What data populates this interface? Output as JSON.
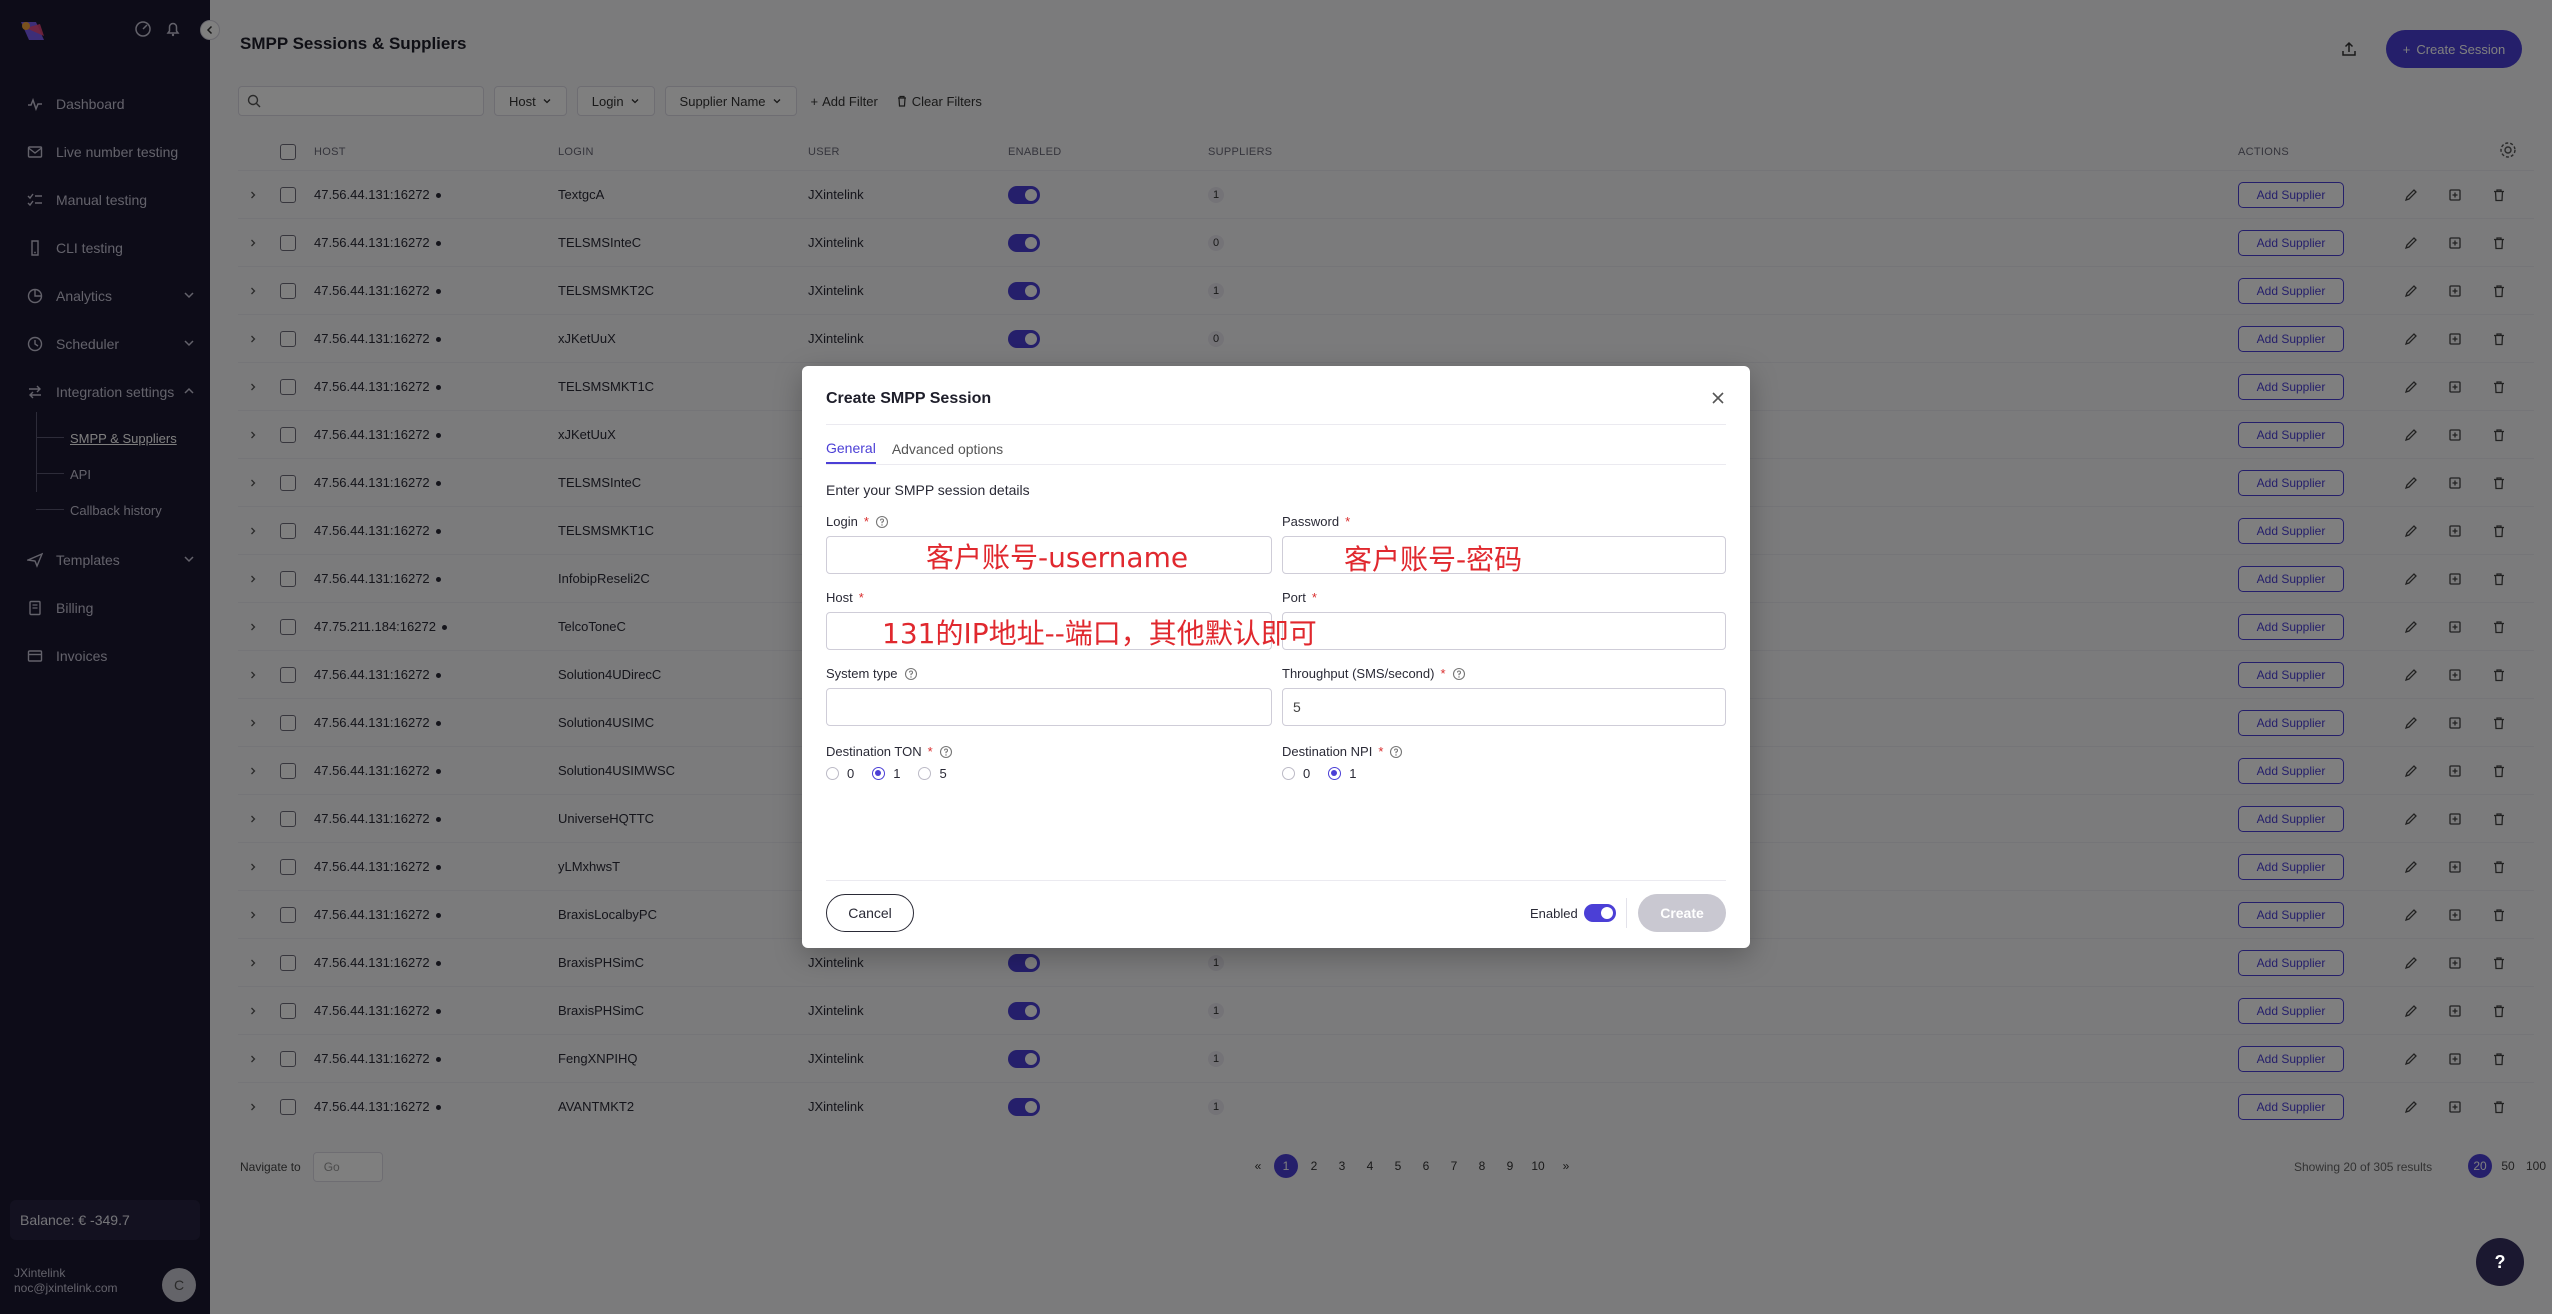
{
  "sidebar": {
    "items": [
      {
        "label": "Dashboard",
        "icon": "pulse-icon"
      },
      {
        "label": "Live number testing",
        "icon": "mail-icon"
      },
      {
        "label": "Manual testing",
        "icon": "checklist-icon"
      },
      {
        "label": "CLI testing",
        "icon": "phone-icon"
      },
      {
        "label": "Analytics",
        "icon": "chart-icon"
      },
      {
        "label": "Scheduler",
        "icon": "clock-icon"
      },
      {
        "label": "Integration settings",
        "icon": "arrows-icon"
      }
    ],
    "sub_items": [
      "SMPP & Suppliers",
      "API",
      "Callback history"
    ],
    "items2": [
      {
        "label": "Templates",
        "icon": "send-icon"
      },
      {
        "label": "Billing",
        "icon": "doc-icon"
      },
      {
        "label": "Invoices",
        "icon": "card-icon"
      }
    ],
    "balance": "Balance: € -349.7",
    "user_name": "JXintelink",
    "user_email": "noc@jxintelink.com",
    "avatar_initial": "C"
  },
  "main": {
    "title": "SMPP Sessions & Suppliers",
    "create_button": "Create Session",
    "search_placeholder": "",
    "filters": [
      "Host",
      "Login",
      "Supplier Name"
    ],
    "add_filter": "Add Filter",
    "clear_filters": "Clear Filters",
    "columns": {
      "host": "HOST",
      "login": "LOGIN",
      "user": "USER",
      "enabled": "ENABLED",
      "suppliers": "SUPPLIERS",
      "actions": "ACTIONS"
    },
    "add_supplier_label": "Add Supplier",
    "rows": [
      {
        "host": "47.56.44.131:16272",
        "login": "TextgcA",
        "user": "JXintelink",
        "suppliers": "1"
      },
      {
        "host": "47.56.44.131:16272",
        "login": "TELSMSInteC",
        "user": "JXintelink",
        "suppliers": "0"
      },
      {
        "host": "47.56.44.131:16272",
        "login": "TELSMSMKT2C",
        "user": "JXintelink",
        "suppliers": "1"
      },
      {
        "host": "47.56.44.131:16272",
        "login": "xJKetUuX",
        "user": "JXintelink",
        "suppliers": "0"
      },
      {
        "host": "47.56.44.131:16272",
        "login": "TELSMSMKT1C",
        "user": "",
        "suppliers": ""
      },
      {
        "host": "47.56.44.131:16272",
        "login": "xJKetUuX",
        "user": "",
        "suppliers": ""
      },
      {
        "host": "47.56.44.131:16272",
        "login": "TELSMSInteC",
        "user": "",
        "suppliers": ""
      },
      {
        "host": "47.56.44.131:16272",
        "login": "TELSMSMKT1C",
        "user": "",
        "suppliers": ""
      },
      {
        "host": "47.56.44.131:16272",
        "login": "InfobipReseli2C",
        "user": "",
        "suppliers": ""
      },
      {
        "host": "47.75.211.184:16272",
        "login": "TelcoToneC",
        "user": "",
        "suppliers": ""
      },
      {
        "host": "47.56.44.131:16272",
        "login": "Solution4UDirecC",
        "user": "",
        "suppliers": ""
      },
      {
        "host": "47.56.44.131:16272",
        "login": "Solution4USIMC",
        "user": "",
        "suppliers": ""
      },
      {
        "host": "47.56.44.131:16272",
        "login": "Solution4USIMWSC",
        "user": "",
        "suppliers": ""
      },
      {
        "host": "47.56.44.131:16272",
        "login": "UniverseHQTTC",
        "user": "",
        "suppliers": ""
      },
      {
        "host": "47.56.44.131:16272",
        "login": "yLMxhwsT",
        "user": "",
        "suppliers": ""
      },
      {
        "host": "47.56.44.131:16272",
        "login": "BraxisLocalbyPC",
        "user": "",
        "suppliers": ""
      },
      {
        "host": "47.56.44.131:16272",
        "login": "BraxisPHSimC",
        "user": "JXintelink",
        "suppliers": "1"
      },
      {
        "host": "47.56.44.131:16272",
        "login": "BraxisPHSimC",
        "user": "JXintelink",
        "suppliers": "1"
      },
      {
        "host": "47.56.44.131:16272",
        "login": "FengXNPIHQ",
        "user": "JXintelink",
        "suppliers": "1"
      },
      {
        "host": "47.56.44.131:16272",
        "login": "AVANTMKT2",
        "user": "JXintelink",
        "suppliers": "1"
      }
    ],
    "navigate_label": "Navigate to",
    "navigate_placeholder": "Go",
    "pages": [
      "1",
      "2",
      "3",
      "4",
      "5",
      "6",
      "7",
      "8",
      "9",
      "10"
    ],
    "first_page": "«",
    "last_page": "»",
    "showing": "Showing 20 of 305 results",
    "per_page": [
      "20",
      "50",
      "100"
    ]
  },
  "modal": {
    "title": "Create SMPP Session",
    "tabs": [
      "General",
      "Advanced options"
    ],
    "section_title": "Enter your SMPP session details",
    "login_label": "Login",
    "password_label": "Password",
    "host_label": "Host",
    "port_label": "Port",
    "system_type_label": "System type",
    "throughput_label": "Throughput (SMS/second)",
    "throughput_value": "5",
    "dest_ton_label": "Destination TON",
    "dest_ton_options": [
      "0",
      "1",
      "5"
    ],
    "dest_ton_selected": "1",
    "dest_npi_label": "Destination NPI",
    "dest_npi_options": [
      "0",
      "1"
    ],
    "dest_npi_selected": "1",
    "cancel": "Cancel",
    "enabled_label": "Enabled",
    "create": "Create",
    "annotations": {
      "login": "客户账号-username",
      "password": "客户账号-密码",
      "host": "131的IP地址--端口，其他默认即可"
    }
  },
  "help_fab": "?",
  "colors": {
    "accent": "#4b3fd6",
    "sidebar_bg": "#1b1830",
    "annotation": "#e0282e",
    "required": "#d92d2d"
  }
}
